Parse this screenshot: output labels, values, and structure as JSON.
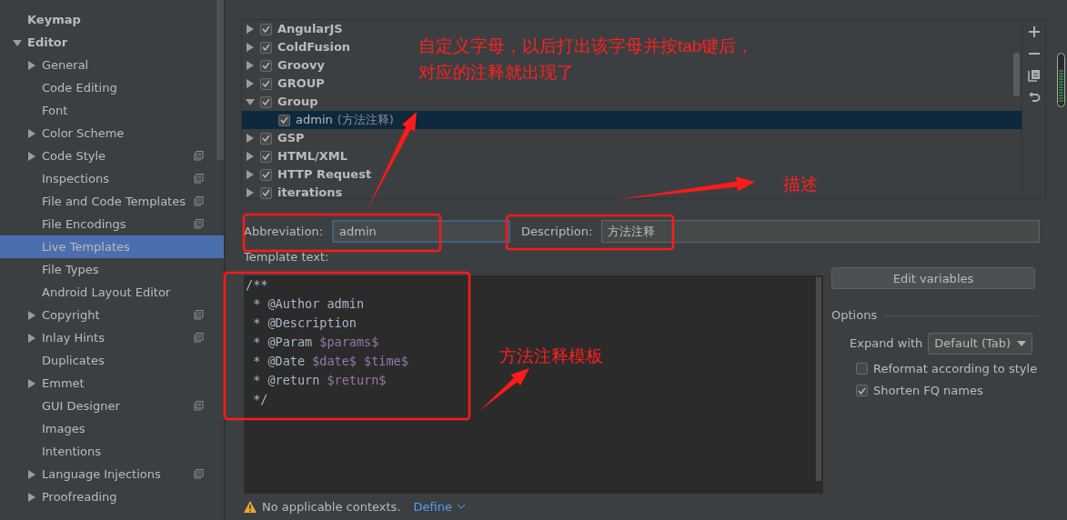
{
  "sidebar": {
    "items": [
      {
        "label": "Keymap",
        "kind": "page",
        "selected": false
      },
      {
        "label": "Editor",
        "kind": "folder",
        "expanded": true,
        "selected": false,
        "children": [
          {
            "label": "General",
            "kind": "folder",
            "expanded": false,
            "selected": false
          },
          {
            "label": "Code Editing",
            "kind": "page",
            "selected": false
          },
          {
            "label": "Font",
            "kind": "page",
            "selected": false
          },
          {
            "label": "Color Scheme",
            "kind": "folder",
            "expanded": false,
            "selected": false
          },
          {
            "label": "Code Style",
            "kind": "folder",
            "expanded": false,
            "selected": false,
            "shared": true
          },
          {
            "label": "Inspections",
            "kind": "page",
            "selected": false,
            "shared": true
          },
          {
            "label": "File and Code Templates",
            "kind": "page",
            "selected": false,
            "shared": true
          },
          {
            "label": "File Encodings",
            "kind": "page",
            "selected": false,
            "shared": true
          },
          {
            "label": "Live Templates",
            "kind": "page",
            "selected": true
          },
          {
            "label": "File Types",
            "kind": "page",
            "selected": false
          },
          {
            "label": "Android Layout Editor",
            "kind": "page",
            "selected": false
          },
          {
            "label": "Copyright",
            "kind": "folder",
            "expanded": false,
            "selected": false,
            "shared": true
          },
          {
            "label": "Inlay Hints",
            "kind": "folder",
            "expanded": false,
            "selected": false,
            "shared": true
          },
          {
            "label": "Duplicates",
            "kind": "page",
            "selected": false
          },
          {
            "label": "Emmet",
            "kind": "folder",
            "expanded": false,
            "selected": false
          },
          {
            "label": "GUI Designer",
            "kind": "page",
            "selected": false,
            "shared": true
          },
          {
            "label": "Images",
            "kind": "page",
            "selected": false
          },
          {
            "label": "Intentions",
            "kind": "page",
            "selected": false
          },
          {
            "label": "Language Injections",
            "kind": "folder",
            "expanded": false,
            "selected": false,
            "shared": true
          },
          {
            "label": "Proofreading",
            "kind": "folder",
            "expanded": false,
            "selected": false
          }
        ]
      }
    ]
  },
  "templates": {
    "groups": [
      {
        "name": "AngularJS",
        "checked": true,
        "expanded": false,
        "selected": false
      },
      {
        "name": "ColdFusion",
        "checked": true,
        "expanded": false,
        "selected": false
      },
      {
        "name": "Groovy",
        "checked": true,
        "expanded": false,
        "selected": false
      },
      {
        "name": "GROUP",
        "checked": true,
        "expanded": false,
        "selected": false
      },
      {
        "name": "Group",
        "checked": true,
        "expanded": true,
        "selected": false,
        "children": [
          {
            "abbreviation": "admin",
            "description": "(方法注释)",
            "checked": true,
            "selected": true
          }
        ]
      },
      {
        "name": "GSP",
        "checked": true,
        "expanded": false,
        "selected": false
      },
      {
        "name": "HTML/XML",
        "checked": true,
        "expanded": false,
        "selected": false
      },
      {
        "name": "HTTP Request",
        "checked": true,
        "expanded": false,
        "selected": false
      },
      {
        "name": "iterations",
        "checked": true,
        "expanded": false,
        "selected": false
      }
    ]
  },
  "abbreviation": {
    "label": "Abbreviation:",
    "value": "admin"
  },
  "description": {
    "label": "Description:",
    "value": "方法注释"
  },
  "template_text": {
    "label": "Template text:",
    "lines": [
      [
        {
          "kind": "text",
          "text": "/**"
        }
      ],
      [
        {
          "kind": "text",
          "text": " * @Author admin"
        }
      ],
      [
        {
          "kind": "text",
          "text": " * @Description"
        }
      ],
      [
        {
          "kind": "text",
          "text": " * @Param "
        },
        {
          "kind": "variable",
          "text": "$params$"
        }
      ],
      [
        {
          "kind": "text",
          "text": " * @Date "
        },
        {
          "kind": "variable",
          "text": "$date$"
        },
        {
          "kind": "variable",
          "text": "$time$"
        }
      ],
      [
        {
          "kind": "text",
          "text": " * @return "
        },
        {
          "kind": "variable",
          "text": "$return$"
        }
      ],
      [
        {
          "kind": "text",
          "text": " */"
        }
      ]
    ]
  },
  "edit_variables_button": "Edit variables",
  "options": {
    "title": "Options",
    "expand_with": {
      "label": "Expand with",
      "value": "Default (Tab)"
    },
    "checkboxes": [
      {
        "label": "Reformat according to style",
        "checked": false
      },
      {
        "label": "Shorten FQ names",
        "checked": true
      }
    ]
  },
  "footer": {
    "warning": "No applicable contexts.",
    "link": "Define"
  },
  "annotations": [
    {
      "text": "自定义字母，以后打出该字母并按tab键后，"
    },
    {
      "text": "对应的注释就出现了"
    },
    {
      "text": "描述"
    },
    {
      "text": "方法注释模板"
    }
  ]
}
